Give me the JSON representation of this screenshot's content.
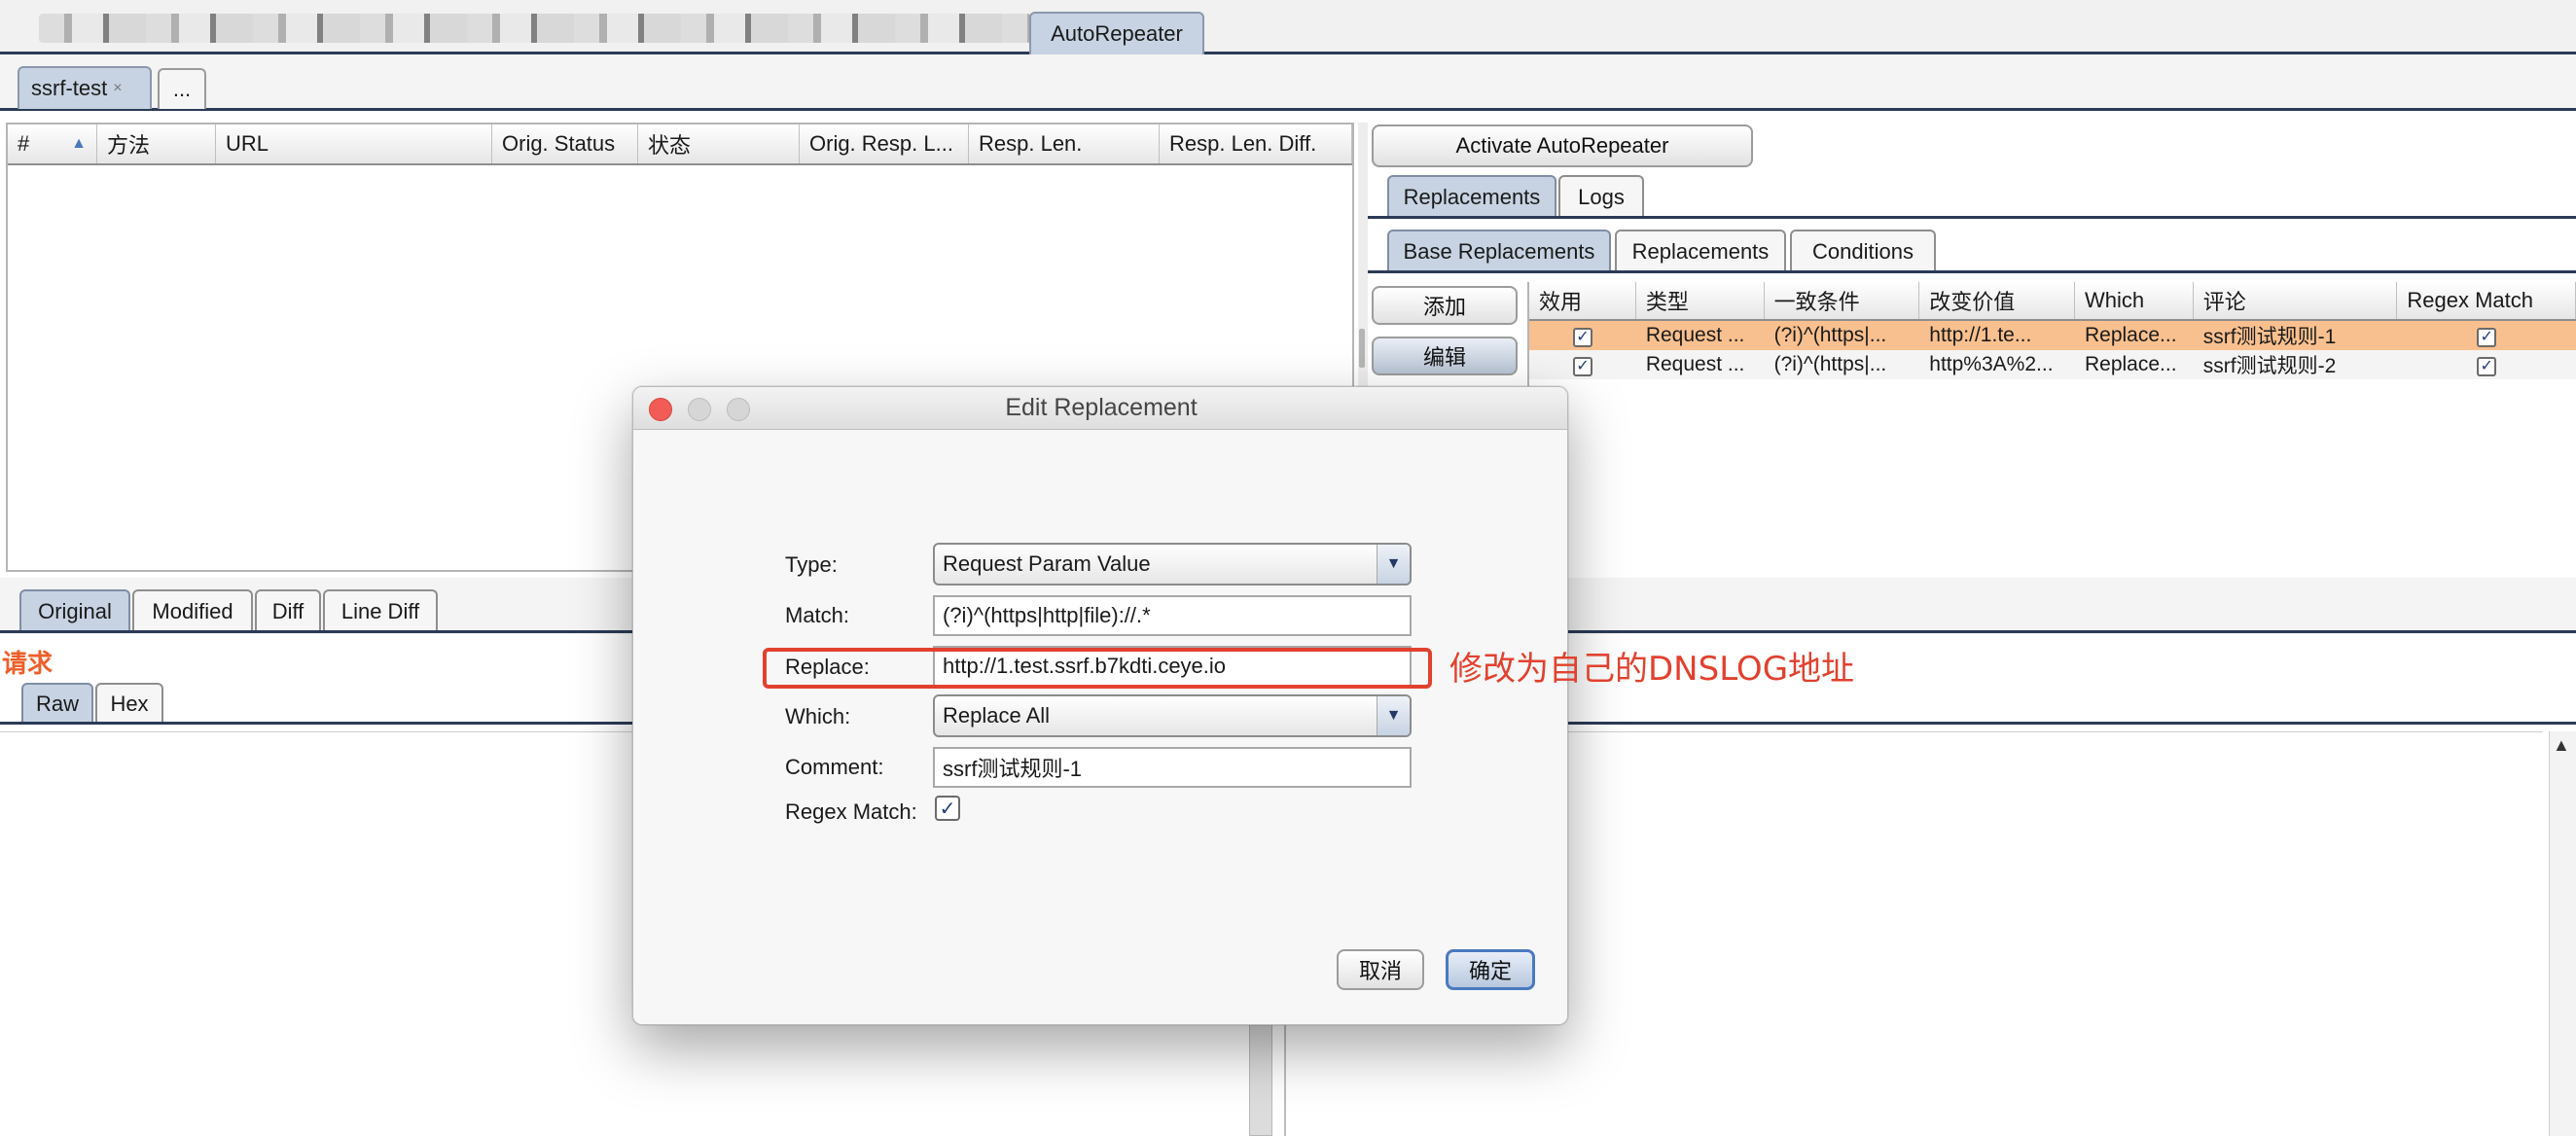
{
  "plugin_tab": {
    "label": "AutoRepeater"
  },
  "session_tabs": {
    "active": "ssrf-test",
    "close": "×",
    "more": "..."
  },
  "log_table": {
    "columns": [
      "#",
      "方法",
      "URL",
      "Orig. Status",
      "状态",
      "Orig. Resp. L...",
      "Resp. Len.",
      "Resp. Len. Diff."
    ],
    "sort_indicator": "▲"
  },
  "right_panel": {
    "activate_button": "Activate AutoRepeater",
    "outer_tabs": [
      "Replacements",
      "Logs"
    ],
    "inner_tabs": [
      "Base Replacements",
      "Replacements",
      "Conditions"
    ],
    "add_button": "添加",
    "edit_button": "编辑",
    "table": {
      "columns": [
        "效用",
        "类型",
        "一致条件",
        "改变价值",
        "Which",
        "评论",
        "Regex Match"
      ],
      "rows": [
        {
          "enabled": "✓",
          "type": "Request ...",
          "match": "(?i)^(https|...",
          "replace": "http://1.te...",
          "which": "Replace...",
          "comment": "ssrf测试规则-1",
          "regex": "✓"
        },
        {
          "enabled": "✓",
          "type": "Request ...",
          "match": "(?i)^(https|...",
          "replace": "http%3A%2...",
          "which": "Replace...",
          "comment": "ssrf测试规则-2",
          "regex": "✓"
        }
      ]
    }
  },
  "viewer": {
    "tabs": [
      "Original",
      "Modified",
      "Diff",
      "Line Diff"
    ],
    "request_label": "请求",
    "format_tabs": [
      "Raw",
      "Hex"
    ]
  },
  "dialog": {
    "title": "Edit Replacement",
    "type_label": "Type:",
    "type_value": "Request Param Value",
    "match_label": "Match:",
    "match_value": "(?i)^(https|http|file)://.*",
    "replace_label": "Replace:",
    "replace_value": "http://1.test.ssrf.b7kdti.ceye.io",
    "which_label": "Which:",
    "which_value": "Replace All",
    "comment_label": "Comment:",
    "comment_value": "ssrf测试规则-1",
    "regex_label": "Regex Match:",
    "regex_checked": "✓",
    "cancel_button": "取消",
    "ok_button": "确定"
  },
  "annotation": {
    "text": "修改为自己的DNSLOG地址",
    "color": "#e2412f"
  },
  "colors": {
    "selected_row": "#f9c08f",
    "tab_selected": "#c7d3e2",
    "separator": "#2b3a57",
    "request_label": "#ee5f2a"
  }
}
